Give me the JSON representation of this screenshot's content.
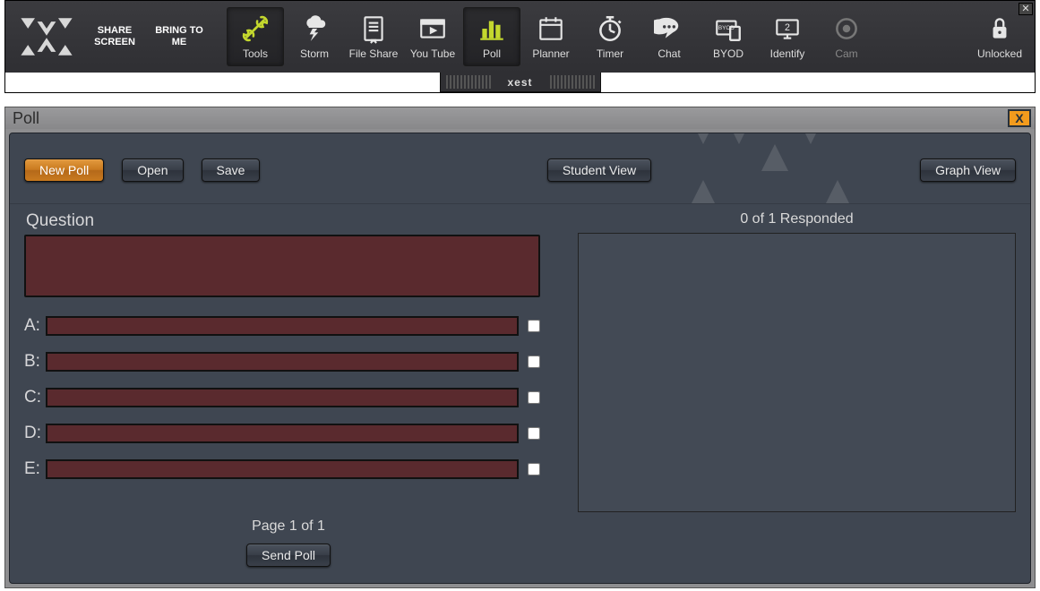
{
  "app": {
    "brand_handle": "xest",
    "close_glyph": "✕",
    "text_buttons": {
      "share_screen": "SHARE SCREEN",
      "bring_to_me": "BRING TO ME"
    },
    "toolbar": [
      {
        "id": "tools",
        "label": "Tools",
        "selected": true,
        "accent": true
      },
      {
        "id": "storm",
        "label": "Storm"
      },
      {
        "id": "fileshare",
        "label": "File Share"
      },
      {
        "id": "youtube",
        "label": "You Tube"
      },
      {
        "id": "poll",
        "label": "Poll",
        "selected": true,
        "accent": true
      },
      {
        "id": "planner",
        "label": "Planner"
      },
      {
        "id": "timer",
        "label": "Timer"
      },
      {
        "id": "chat",
        "label": "Chat"
      },
      {
        "id": "byod",
        "label": "BYOD"
      },
      {
        "id": "identify",
        "label": "Identify"
      },
      {
        "id": "cam",
        "label": "Cam",
        "dim": true
      }
    ],
    "lock": {
      "label": "Unlocked"
    }
  },
  "panel": {
    "title": "Poll",
    "close_glyph": "X",
    "buttons": {
      "new_poll": "New Poll",
      "open": "Open",
      "save": "Save",
      "student_view": "Student View",
      "graph_view": "Graph View",
      "send_poll": "Send Poll"
    },
    "question_label": "Question",
    "question_value": "",
    "answers": [
      {
        "key": "A:",
        "value": "",
        "checked": false
      },
      {
        "key": "B:",
        "value": "",
        "checked": false
      },
      {
        "key": "C:",
        "value": "",
        "checked": false
      },
      {
        "key": "D:",
        "value": "",
        "checked": false
      },
      {
        "key": "E:",
        "value": "",
        "checked": false
      }
    ],
    "pager": "Page 1 of 1",
    "responded": "0 of 1 Responded"
  }
}
